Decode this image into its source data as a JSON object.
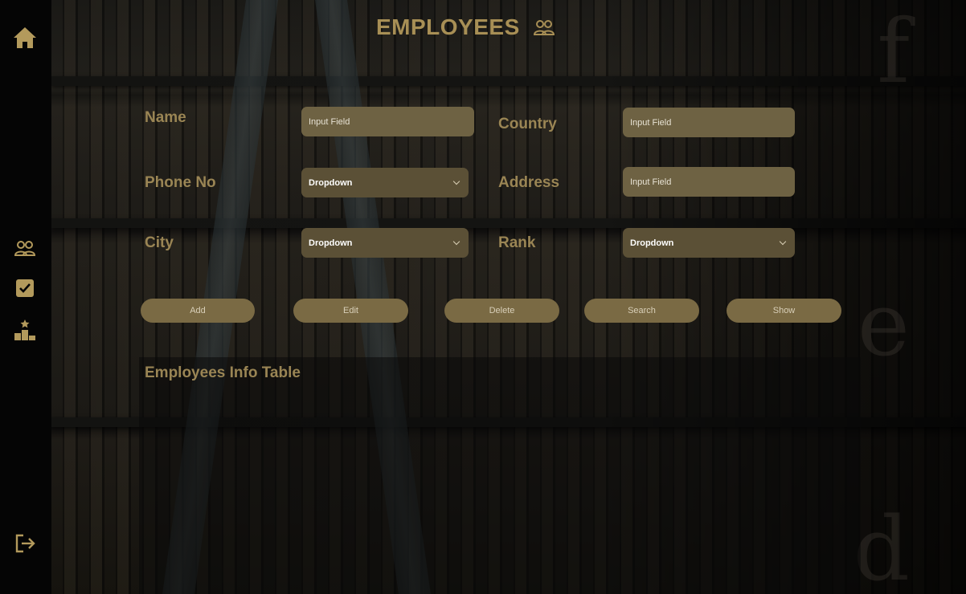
{
  "header": {
    "title": "EMPLOYEES",
    "icon": "users-icon"
  },
  "sidebar": {
    "items": [
      {
        "name": "home",
        "icon": "home-icon"
      },
      {
        "name": "employees",
        "icon": "users-icon"
      },
      {
        "name": "tasks",
        "icon": "checkbox-icon"
      },
      {
        "name": "rankings",
        "icon": "podium-icon"
      },
      {
        "name": "logout",
        "icon": "logout-icon"
      }
    ]
  },
  "form": {
    "name": {
      "label": "Name",
      "value": "Input Field"
    },
    "country": {
      "label": "Country",
      "value": "Input Field"
    },
    "phone": {
      "label": "Phone No",
      "value": "Dropdown"
    },
    "address": {
      "label": "Address",
      "value": "Input Field"
    },
    "city": {
      "label": "City",
      "value": "Dropdown"
    },
    "rank": {
      "label": "Rank",
      "value": "Dropdown"
    }
  },
  "actions": {
    "add": "Add",
    "edit": "Edit",
    "delete": "Delete",
    "search": "Search",
    "show": "Show"
  },
  "table": {
    "title": "Employees Info Table"
  },
  "colors": {
    "accent": "#a88f55",
    "field": "#6e6243",
    "button": "#7a6a44",
    "sidebar": "#050505"
  }
}
